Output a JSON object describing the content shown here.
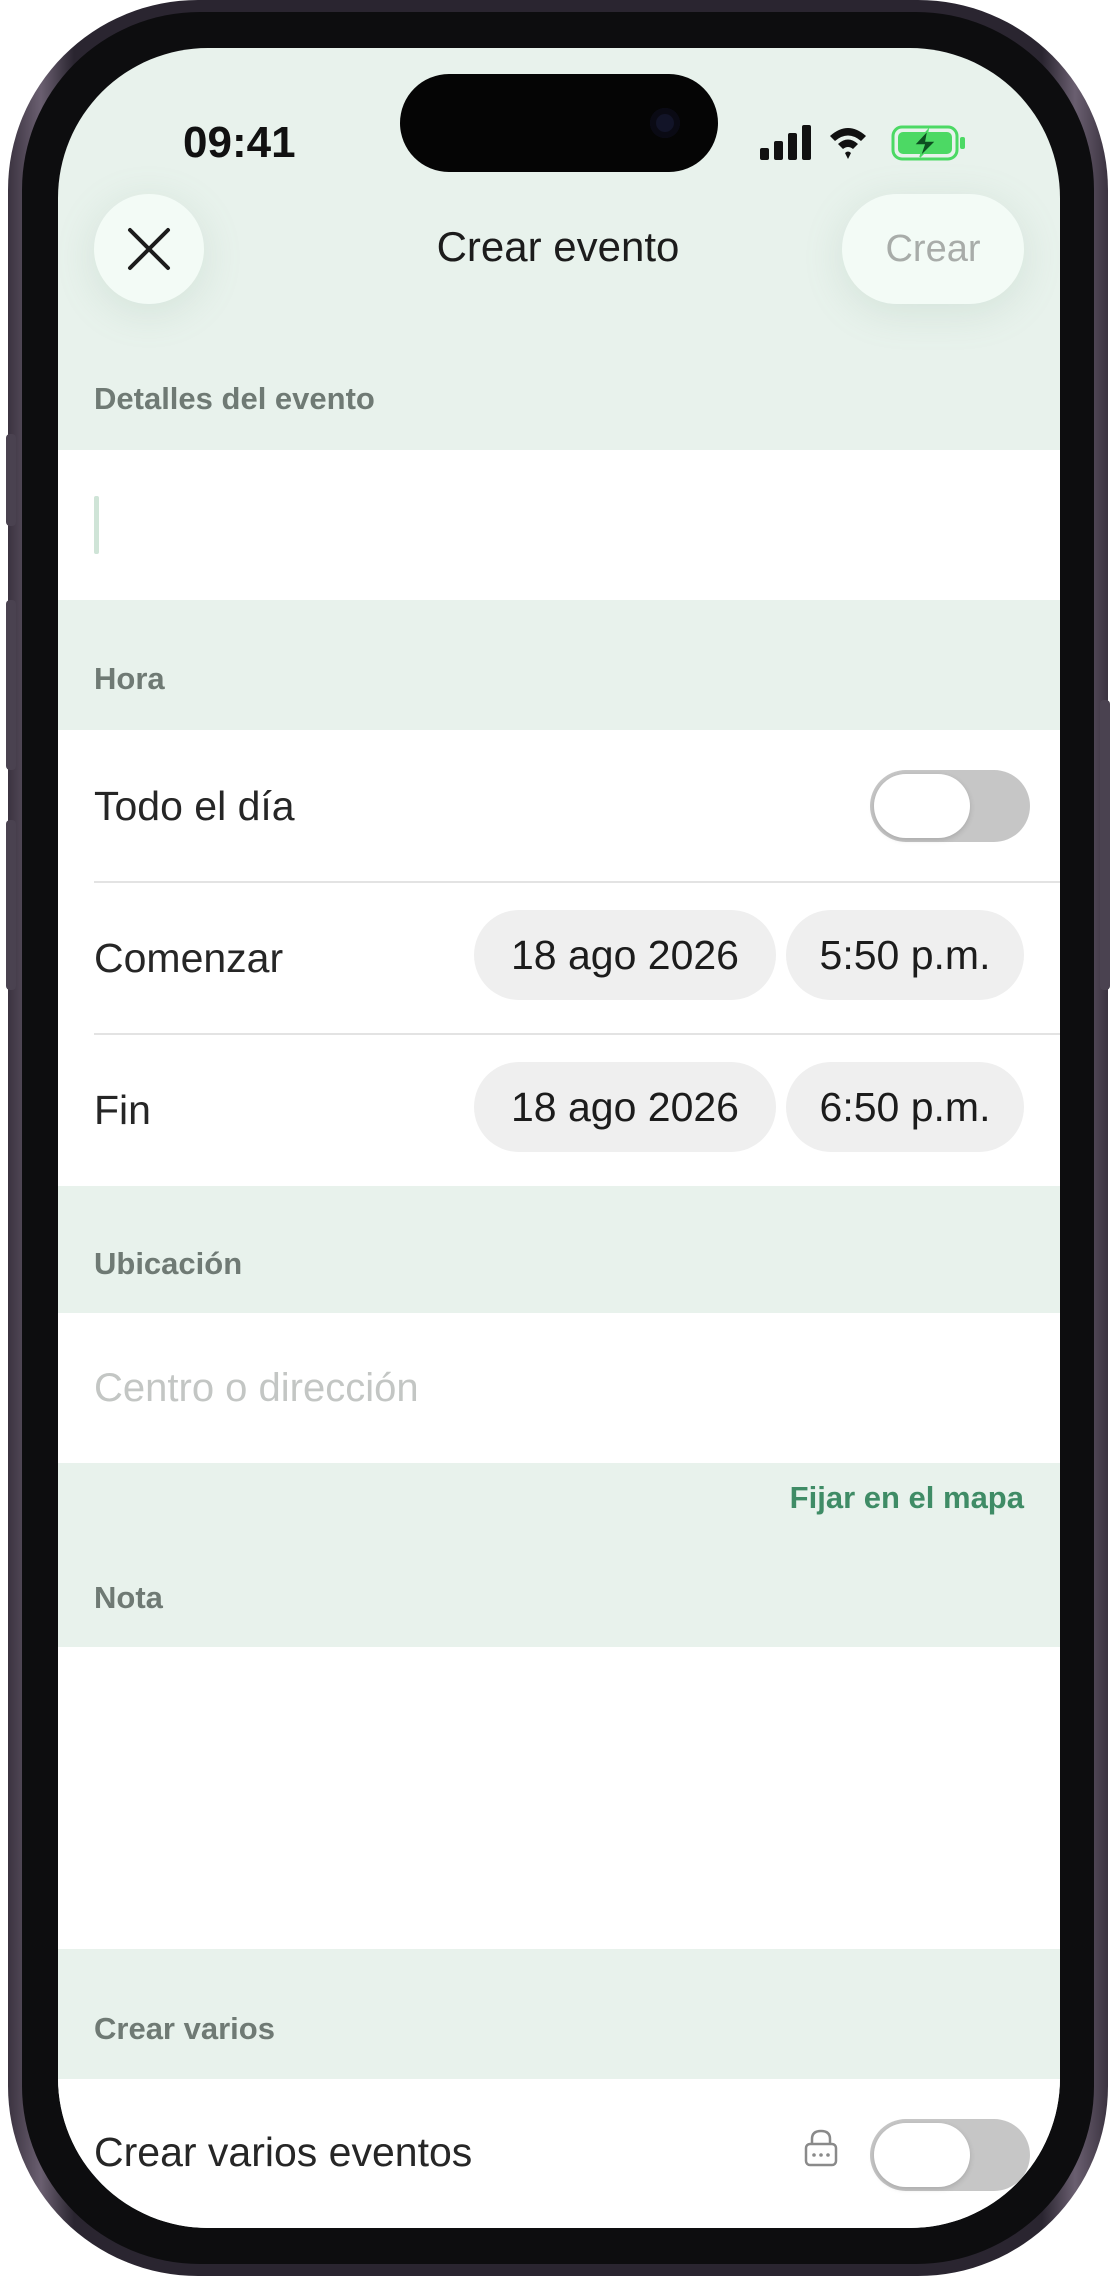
{
  "status_bar": {
    "time": "09:41"
  },
  "header": {
    "title": "Crear evento",
    "create_label": "Crear"
  },
  "sections": {
    "details": {
      "label": "Detalles del evento"
    },
    "time": {
      "label": "Hora",
      "all_day_label": "Todo el día",
      "all_day_on": false,
      "start": {
        "label": "Comenzar",
        "date": "18 ago 2026",
        "time": "5:50 p.m."
      },
      "end": {
        "label": "Fin",
        "date": "18 ago 2026",
        "time": "6:50 p.m."
      }
    },
    "location": {
      "label": "Ubicación",
      "placeholder": "Centro o dirección",
      "map_link": "Fijar en el mapa"
    },
    "note": {
      "label": "Nota"
    },
    "multiple": {
      "label": "Crear varios",
      "multiple_events_label": "Crear varios eventos",
      "multiple_on": false
    }
  },
  "colors": {
    "background": "#e8f2ec",
    "accent": "#3f8c66",
    "toggle_off": "#c6c6c6",
    "battery": "#4cd964"
  }
}
